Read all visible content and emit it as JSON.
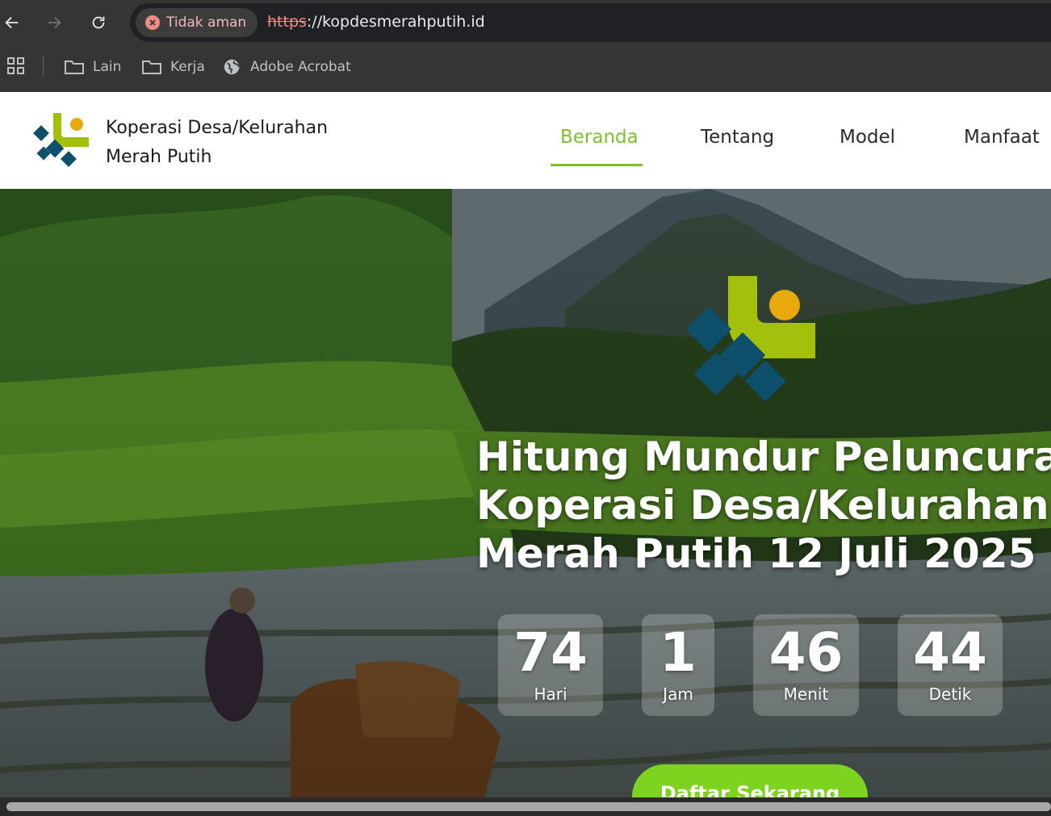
{
  "browser": {
    "security_label": "Tidak aman",
    "url_scheme": "https",
    "url_rest": "://kopdesmerahputih.id",
    "bookmarks": [
      {
        "label": "Lain",
        "icon": "folder-icon"
      },
      {
        "label": "Kerja",
        "icon": "folder-icon"
      },
      {
        "label": "Adobe Acrobat",
        "icon": "globe-icon"
      }
    ]
  },
  "site": {
    "brand_line1": "Koperasi Desa/Kelurahan",
    "brand_line2": "Merah Putih",
    "nav": [
      {
        "label": "Beranda",
        "active": true
      },
      {
        "label": "Tentang",
        "active": false
      },
      {
        "label": "Model",
        "active": false
      },
      {
        "label": "Manfaat",
        "active": false
      }
    ],
    "colors": {
      "accent_green": "#7cc02c",
      "logo_lime": "#a3c10c",
      "logo_teal": "#0e4f6b",
      "logo_yellow": "#e8a90d"
    }
  },
  "hero": {
    "title_line1": "Hitung Mundur Peluncuran",
    "title_line2": "Koperasi Desa/Kelurahan",
    "title_line3": "Merah Putih 12 Juli 2025",
    "countdown": [
      {
        "value": "74",
        "label": "Hari"
      },
      {
        "value": "1",
        "label": "Jam"
      },
      {
        "value": "46",
        "label": "Menit"
      },
      {
        "value": "44",
        "label": "Detik"
      }
    ],
    "cta_label": "Daftar Sekarang"
  }
}
